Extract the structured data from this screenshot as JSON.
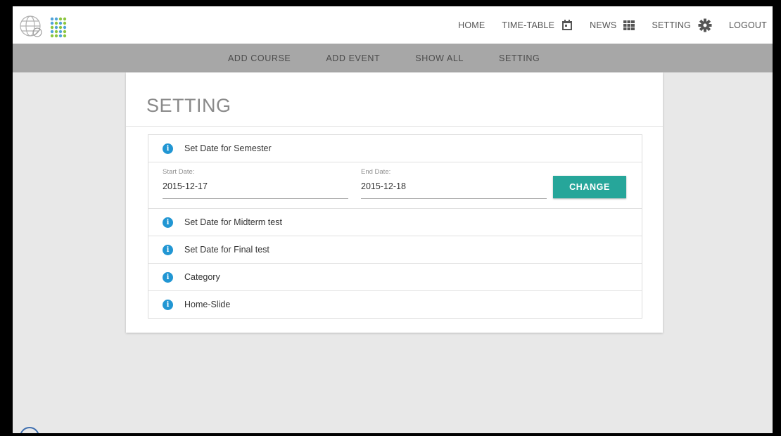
{
  "topnav": {
    "items": [
      {
        "label": "HOME",
        "icon": ""
      },
      {
        "label": "TIME-TABLE",
        "icon": "calendar-icon"
      },
      {
        "label": "NEWS",
        "icon": "grid-icon"
      },
      {
        "label": "SETTING",
        "icon": "gear-icon"
      },
      {
        "label": "LOGOUT",
        "icon": ""
      }
    ]
  },
  "subnav": {
    "items": [
      {
        "label": "ADD COURSE"
      },
      {
        "label": "ADD EVENT"
      },
      {
        "label": "SHOW ALL"
      },
      {
        "label": "SETTING"
      }
    ]
  },
  "card": {
    "title": "SETTING"
  },
  "accordion": {
    "semester": {
      "label": "Set Date for Semester",
      "start_label": "Start Date:",
      "start_value": "2015-12-17",
      "end_label": "End Date:",
      "end_value": "2015-12-18",
      "button_label": "CHANGE"
    },
    "rows": [
      {
        "label": "Set Date for Midterm test"
      },
      {
        "label": "Set Date for Final test"
      },
      {
        "label": "Category"
      },
      {
        "label": "Home-Slide"
      }
    ]
  },
  "colors": {
    "accent": "#26a69a",
    "info": "#2196d3",
    "subbar": "#a7a7a7",
    "background": "#e8e8e8"
  }
}
